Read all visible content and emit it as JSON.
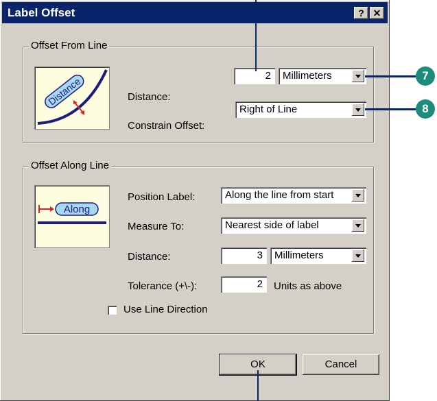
{
  "window": {
    "title": "Label Offset",
    "help_label": "?",
    "close_label": "✕"
  },
  "offset_from_line": {
    "group_label": "Offset From Line",
    "illustration_text": "Distance",
    "distance_label": "Distance:",
    "distance_value": "2",
    "distance_unit": "Millimeters",
    "constrain_label": "Constrain Offset:",
    "constrain_value": "Right of Line"
  },
  "offset_along_line": {
    "group_label": "Offset Along Line",
    "illustration_text": "Along",
    "position_label": "Position Label:",
    "position_value": "Along the line from start",
    "measure_label": "Measure To:",
    "measure_value": "Nearest side of label",
    "distance_label": "Distance:",
    "distance_value": "3",
    "distance_unit": "Millimeters",
    "tolerance_label": "Tolerance (+\\-):",
    "tolerance_value": "2",
    "tolerance_units": "Units as above",
    "use_direction_label": "Use Line Direction"
  },
  "buttons": {
    "ok": "OK",
    "cancel": "Cancel"
  },
  "callouts": {
    "c7": "7",
    "c8": "8"
  },
  "colors": {
    "titlebar": "#0a246a",
    "callout": "#1c8c7c",
    "illustration_line": "#1c1c7c",
    "arrow": "#e0202a"
  }
}
